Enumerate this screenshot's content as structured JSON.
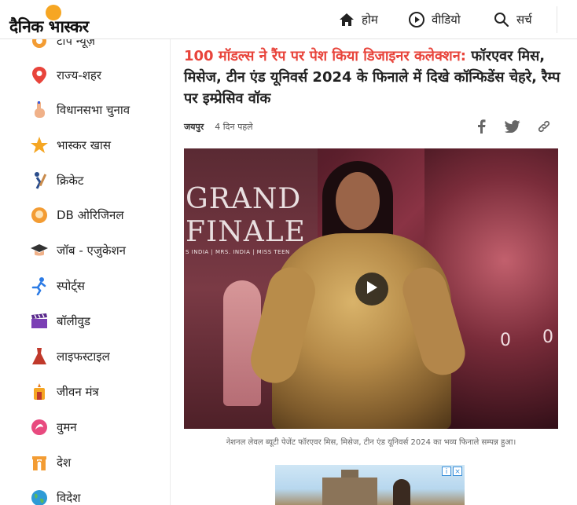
{
  "header": {
    "logo_text": "दैनिक भास्कर",
    "nav": [
      {
        "label": "होम",
        "icon": "home-icon"
      },
      {
        "label": "वीडियो",
        "icon": "play-circle-icon"
      },
      {
        "label": "सर्च",
        "icon": "search-icon"
      }
    ]
  },
  "sidebar": {
    "items": [
      {
        "label": "टॉप न्यूज़",
        "icon": "top-news-icon"
      },
      {
        "label": "राज्य-शहर",
        "icon": "location-pin-icon"
      },
      {
        "label": "विधानसभा चुनाव",
        "icon": "voting-finger-icon"
      },
      {
        "label": "भास्कर खास",
        "icon": "star-icon"
      },
      {
        "label": "क्रिकेट",
        "icon": "cricket-bat-icon"
      },
      {
        "label": "DB ओरिजिनल",
        "icon": "db-original-icon"
      },
      {
        "label": "जॉब - एजुकेशन",
        "icon": "graduation-cap-icon"
      },
      {
        "label": "स्पोर्ट्स",
        "icon": "runner-icon"
      },
      {
        "label": "बॉलीवुड",
        "icon": "clapperboard-icon"
      },
      {
        "label": "लाइफस्टाइल",
        "icon": "dress-icon"
      },
      {
        "label": "जीवन मंत्र",
        "icon": "temple-lamp-icon"
      },
      {
        "label": "वुमन",
        "icon": "woman-icon"
      },
      {
        "label": "देश",
        "icon": "india-gate-icon"
      },
      {
        "label": "विदेश",
        "icon": "globe-icon"
      }
    ]
  },
  "article": {
    "headline_highlight": "100 मॉडल्स ने रैंप पर पेश किया डिजाइनर कलेक्शन:",
    "headline_rest": " फॉरएवर मिस, मिसेज, टीन एंड यूनिवर्स 2024 के फिनाले में दिखे कॉन्फिडेंस चेहरे, रैम्प पर इम्प्रेसिव वॉक",
    "city": "जयपुर",
    "time": "4 दिन पहले",
    "share": [
      "facebook-icon",
      "twitter-icon",
      "link-icon"
    ],
    "video": {
      "grand_text_1": "GRAND",
      "grand_text_2": "FINALE",
      "sub_text": "S INDIA | MRS. INDIA | MISS TEEN",
      "zero_1": "0",
      "zero_2": "0"
    },
    "caption": "नेशनल लेवल ब्यूटी पेजेंट फॉरएवर मिस, मिसेज, टीन एंड यूनिवर्स 2024 का भव्य फिनाले सम्पन्न हुआ।"
  },
  "colors": {
    "accent": "#e8443b",
    "logo_sun": "#f6a623"
  }
}
